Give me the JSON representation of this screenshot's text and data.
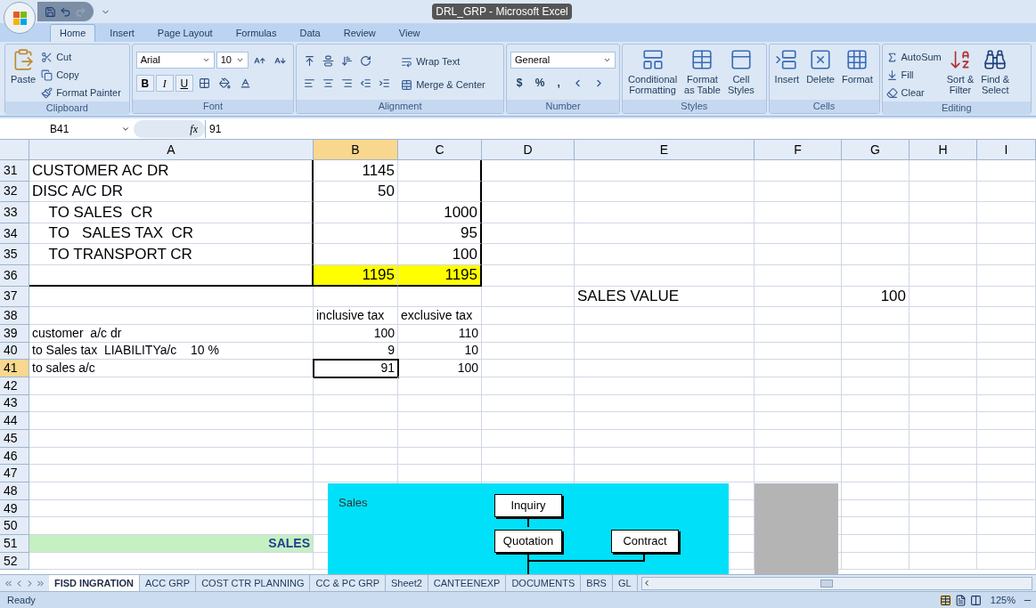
{
  "window": {
    "title": "DRL_GRP - Microsoft Excel"
  },
  "ribbon_tabs": [
    {
      "label": "Home",
      "selected": true
    },
    {
      "label": "Insert",
      "selected": false
    },
    {
      "label": "Page Layout",
      "selected": false
    },
    {
      "label": "Formulas",
      "selected": false
    },
    {
      "label": "Data",
      "selected": false
    },
    {
      "label": "Review",
      "selected": false
    },
    {
      "label": "View",
      "selected": false
    }
  ],
  "clipboard": {
    "label": "Clipboard",
    "paste": "Paste",
    "cut": "Cut",
    "copy": "Copy",
    "format_painter": "Format Painter"
  },
  "font": {
    "label": "Font",
    "font_name": "Arial",
    "font_size": "10",
    "bold": "B",
    "italic": "I",
    "underline": "U"
  },
  "alignment": {
    "label": "Alignment",
    "wrap_text": "Wrap Text",
    "merge": "Merge & Center"
  },
  "number": {
    "label": "Number",
    "format": "General",
    "currency": "$",
    "percent": "%",
    "comma": ","
  },
  "styles": {
    "label": "Styles",
    "buttons": [
      [
        "Conditional",
        "Formatting"
      ],
      [
        "Format",
        "as Table"
      ],
      [
        "Cell",
        "Styles"
      ]
    ]
  },
  "cells": {
    "label": "Cells",
    "buttons": [
      "Insert",
      "Delete",
      "Format"
    ]
  },
  "editing": {
    "label": "Editing",
    "autosum": "AutoSum",
    "fill": "Fill",
    "clear": "Clear",
    "sort": [
      "Sort &",
      "Filter"
    ],
    "find": [
      "Find &",
      "Select"
    ]
  },
  "formula_bar": {
    "name_box": "B41",
    "fx": "fx",
    "value": "91"
  },
  "columns": [
    {
      "label": "A",
      "selected": false
    },
    {
      "label": "B",
      "selected": true
    },
    {
      "label": "C",
      "selected": false
    },
    {
      "label": "D",
      "selected": false
    },
    {
      "label": "E",
      "selected": false
    },
    {
      "label": "F",
      "selected": false
    },
    {
      "label": "G",
      "selected": false
    },
    {
      "label": "H",
      "selected": false
    },
    {
      "label": "I",
      "selected": false
    }
  ],
  "rows": [
    {
      "number": "31",
      "selected": false,
      "large": true,
      "cells": {
        "A": {
          "text": "CUSTOMER AC DR",
          "border_right": true
        },
        "B": {
          "text": "1145",
          "align_right": true
        },
        "C": {
          "border_right": true
        }
      }
    },
    {
      "number": "32",
      "selected": false,
      "large": true,
      "cells": {
        "A": {
          "text": "DISC A/C DR",
          "border_right": true
        },
        "B": {
          "text": "50",
          "align_right": true
        },
        "C": {
          "border_right": true
        }
      }
    },
    {
      "number": "33",
      "selected": false,
      "large": true,
      "cells": {
        "A": {
          "text": "    TO SALES  CR",
          "border_right": true
        },
        "C": {
          "text": "1000",
          "align_right": true,
          "border_right": true
        }
      }
    },
    {
      "number": "34",
      "selected": false,
      "large": true,
      "cells": {
        "A": {
          "text": "    TO   SALES TAX  CR",
          "border_right": true
        },
        "C": {
          "text": "95",
          "align_right": true,
          "border_right": true
        }
      }
    },
    {
      "number": "35",
      "selected": false,
      "large": true,
      "cells": {
        "A": {
          "text": "    TO TRANSPORT CR",
          "border_right": true
        },
        "C": {
          "text": "100",
          "align_right": true,
          "border_right": true
        }
      }
    },
    {
      "number": "36",
      "selected": false,
      "large": true,
      "cells": {
        "A": {
          "border_right": true,
          "border_bottom": true
        },
        "B": {
          "text": "1195",
          "align_right": true,
          "color": "#ffff00",
          "border_bottom": true
        },
        "C": {
          "text": "1195",
          "align_right": true,
          "color": "#ffff00",
          "border_right": true,
          "border_bottom": true
        }
      }
    },
    {
      "number": "37",
      "selected": false,
      "large": true,
      "cells": {
        "E": {
          "text": "SALES VALUE"
        },
        "G": {
          "text": "100",
          "align_right": true
        }
      }
    },
    {
      "number": "38",
      "selected": false,
      "large": false,
      "cells": {
        "B": {
          "text": "inclusive tax"
        },
        "C": {
          "text": "exclusive tax"
        }
      }
    },
    {
      "number": "39",
      "selected": false,
      "large": false,
      "cells": {
        "A": {
          "text": "customer  a/c dr"
        },
        "B": {
          "text": "100",
          "align_right": true
        },
        "C": {
          "text": "110",
          "align_right": true
        }
      }
    },
    {
      "number": "40",
      "selected": false,
      "large": false,
      "cells": {
        "A": {
          "text": "to Sales tax  LIABILITYa/c    10 %"
        },
        "B": {
          "text": "9",
          "align_right": true
        },
        "C": {
          "text": "10",
          "align_right": true
        }
      }
    },
    {
      "number": "41",
      "selected": true,
      "large": false,
      "cells": {
        "A": {
          "text": "to sales a/c"
        },
        "B": {
          "text": "91",
          "align_right": true,
          "selected": true
        },
        "C": {
          "text": "100",
          "align_right": true
        }
      }
    },
    {
      "number": "42",
      "selected": false,
      "large": false,
      "cells": {}
    },
    {
      "number": "43",
      "selected": false,
      "large": false,
      "cells": {}
    },
    {
      "number": "44",
      "selected": false,
      "large": false,
      "cells": {}
    },
    {
      "number": "45",
      "selected": false,
      "large": false,
      "cells": {}
    },
    {
      "number": "46",
      "selected": false,
      "large": false,
      "cells": {}
    },
    {
      "number": "47",
      "selected": false,
      "large": false,
      "cells": {}
    },
    {
      "number": "48",
      "selected": false,
      "large": false,
      "cells": {}
    },
    {
      "number": "49",
      "selected": false,
      "large": false,
      "cells": {}
    },
    {
      "number": "50",
      "selected": false,
      "large": false,
      "cells": {}
    },
    {
      "number": "51",
      "selected": false,
      "large": false,
      "cells": {
        "A": {
          "text": "SALES",
          "align_right": true,
          "color": "#c6f0c2",
          "bold": true
        }
      }
    },
    {
      "number": "52",
      "selected": false,
      "large": false,
      "cells": {}
    }
  ],
  "diagram": {
    "title": "Sales",
    "nodes": [
      "Inquiry",
      "Quotation",
      "Contract"
    ]
  },
  "sheet_tabs": [
    {
      "label": "FISD INGRATION",
      "selected": true
    },
    {
      "label": "ACC GRP",
      "selected": false
    },
    {
      "label": "COST CTR PLANNING",
      "selected": false
    },
    {
      "label": "CC & PC GRP",
      "selected": false
    },
    {
      "label": "Sheet2",
      "selected": false
    },
    {
      "label": "CANTEENEXP",
      "selected": false
    },
    {
      "label": "DOCUMENTS",
      "selected": false
    },
    {
      "label": "BRS",
      "selected": false
    },
    {
      "label": "GL",
      "selected": false
    }
  ],
  "status_bar": {
    "status": "Ready",
    "zoom": "125%"
  }
}
